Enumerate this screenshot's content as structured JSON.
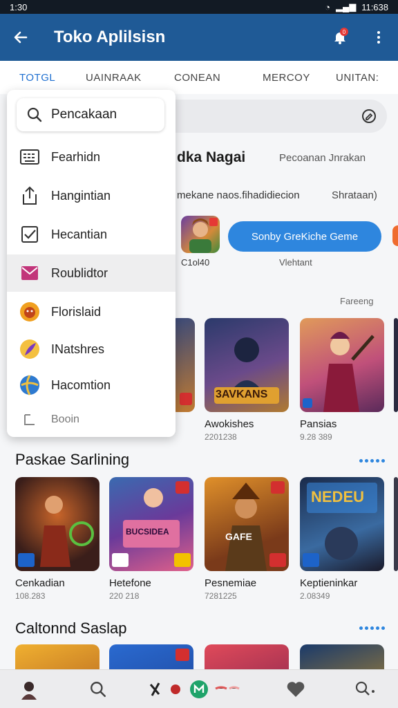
{
  "status": {
    "time": "1:30",
    "right": "11:638"
  },
  "appbar": {
    "title": "Toko Aplilsisn",
    "notif_count": "0"
  },
  "tabs": [
    "TOTGL",
    "UAINRAAK",
    "CONEAN",
    "MERCOY",
    "UNITAN:"
  ],
  "dropdown": {
    "search_label": "Pencakaan",
    "items": [
      {
        "label": "Fearhidn",
        "icon": "keyboard-icon"
      },
      {
        "label": "Hangintian",
        "icon": "share-upload-icon"
      },
      {
        "label": "Hecantian",
        "icon": "checkbox-icon"
      },
      {
        "label": "Roublidtor",
        "icon": "mail-icon"
      },
      {
        "label": "Florislaid",
        "icon": "lion-badge-icon"
      },
      {
        "label": "INatshres",
        "icon": "feather-icon"
      },
      {
        "label": "Hacomtion",
        "icon": "globe-icon"
      }
    ],
    "footer": "Booin"
  },
  "header": {
    "title": "dka Nagai",
    "right": "Pecoanan Jnrakan",
    "subtitle": "mekane naos.fihadidiecion",
    "subtitle_right": "Shrataan)"
  },
  "promo": {
    "app_label": "C1ol40",
    "button": "Sonby GreKiche Geme",
    "sub": "Vlehtant"
  },
  "section_right": "Fareeng",
  "row1": [
    {
      "name": "Awokishes",
      "meta": "2201238",
      "colors": [
        "#2b3a6b",
        "#b07a30"
      ],
      "art": "3AVKANS"
    },
    {
      "name": "Pansias",
      "meta": "9.28 389",
      "colors": [
        "#e08a4a",
        "#7a2a5a"
      ],
      "art": ""
    }
  ],
  "section2": {
    "title": "Paskae Sarlining",
    "cards": [
      {
        "name": "Cenkadian",
        "meta": "108.283",
        "colors": [
          "#3a1e1a",
          "#c9652a"
        ],
        "art": ""
      },
      {
        "name": "Hetefone",
        "meta": "220 218",
        "colors": [
          "#5a3a9a",
          "#e0608a"
        ],
        "art": "BUCSIDEA"
      },
      {
        "name": "Pesnemiae",
        "meta": "7281225",
        "colors": [
          "#7a3a1a",
          "#e0902a"
        ],
        "art": "GAFE"
      },
      {
        "name": "Keptieninkar",
        "meta": "2.08349",
        "colors": [
          "#1a2a4a",
          "#3a6aa0"
        ],
        "art": "NEDEU"
      }
    ]
  },
  "section3": {
    "title": "Caltonnd Saslap"
  },
  "bottom_nav": [
    "avatar",
    "search-icon",
    "games-icon",
    "heart-icon",
    "search-plus-icon"
  ],
  "colors": {
    "appbar": "#1f5a96",
    "accent": "#1e6fd0",
    "button": "#2e86de"
  }
}
